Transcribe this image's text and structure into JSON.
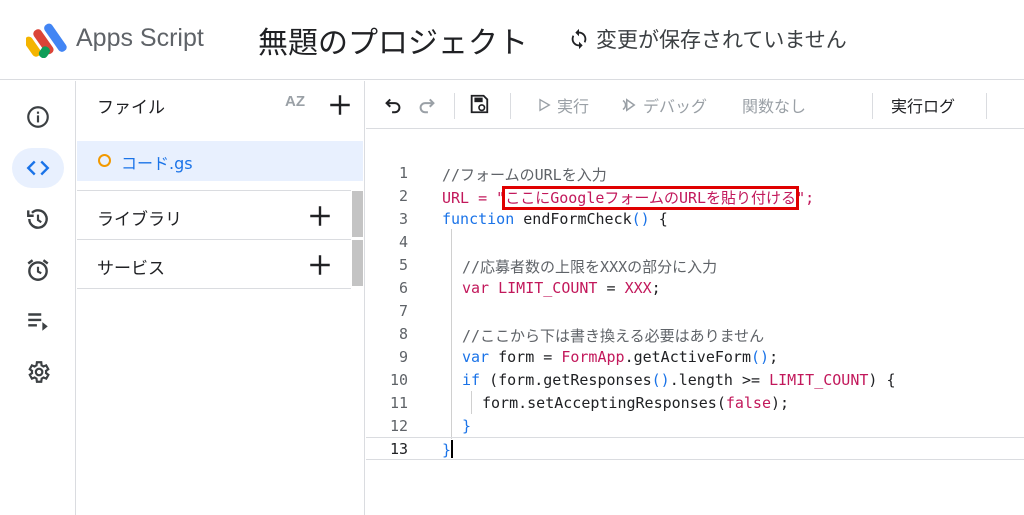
{
  "header": {
    "app_name": "Apps Script",
    "project_title": "無題のプロジェクト",
    "save_status": "変更が保存されていません"
  },
  "rail": {
    "items": [
      {
        "icon": "info-icon"
      },
      {
        "icon": "code-icon",
        "active": true
      },
      {
        "icon": "history-icon"
      },
      {
        "icon": "alarm-icon"
      },
      {
        "icon": "executions-icon"
      },
      {
        "icon": "gear-icon"
      }
    ]
  },
  "files_panel": {
    "label": "ファイル",
    "sort_label": "AZ",
    "file": "コード.gs",
    "libraries_label": "ライブラリ",
    "services_label": "サービス"
  },
  "toolbar": {
    "run_label": "実行",
    "debug_label": "デバッグ",
    "function_label": "関数なし",
    "log_label": "実行ログ"
  },
  "editor": {
    "line_numbers": [
      "1",
      "2",
      "3",
      "4",
      "5",
      "6",
      "7",
      "8",
      "9",
      "10",
      "11",
      "12",
      "13"
    ],
    "lines": {
      "l1": "//フォームのURLを入力",
      "l2_pre": "URL = \"",
      "l2_str": "ここにGoogleフォームのURLを貼り付ける",
      "l2_post": "\";",
      "l3_kw": "function",
      "l3_name": " endFormCheck",
      "l3_paren": "()",
      "l3_brace": " {",
      "l5": "//応募者数の上限をXXXの部分に入力",
      "l6_kw": "var",
      "l6_name": " LIMIT_COUNT",
      "l6_eq": " = ",
      "l6_val": "XXX",
      "l6_end": ";",
      "l8": "//ここから下は書き換える必要はありません",
      "l9_kw": "var",
      "l9_name": " form = ",
      "l9_app": "FormApp",
      "l9_call": ".getActiveForm",
      "l9_paren": "()",
      "l9_end": ";",
      "l10_kw": "if",
      "l10_open": " (",
      "l10_expr": "form.getResponses",
      "l10_paren": "()",
      "l10_len": ".length >= ",
      "l10_const": "LIMIT_COUNT",
      "l10_close": ") {",
      "l11_call": "form.setAcceptingResponses",
      "l11_open": "(",
      "l11_val": "false",
      "l11_close": ");",
      "l12": "}",
      "l13": "}"
    }
  }
}
